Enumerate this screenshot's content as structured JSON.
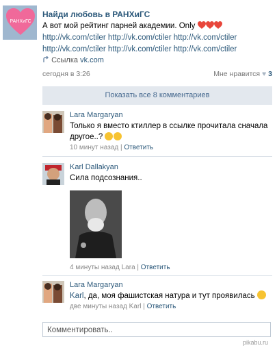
{
  "group": {
    "name": "Найди любовь в РАНХиГС",
    "logo_text": "РАНХиГС"
  },
  "post": {
    "text_line1": "А вот мой рейтинг парней академии. Only",
    "text_line2": "http://vk.com/ctiler http://vk.com/ctiler http://vk.com/ctiler",
    "text_line3": "http://vk.com/ctiler http://vk.com/ctiler http://vk.com/ctiler",
    "link_label": "Ссылка",
    "link_url": "vk.com",
    "timestamp": "сегодня в 3:26",
    "likes_label": "Мне нравится",
    "likes_count": "3"
  },
  "show_all_comments": "Показать все 8 комментариев",
  "comments": [
    {
      "author": "Lara Margaryan",
      "text": "Только я вместо ктиллер в ссылке прочитала сначала другое..?",
      "time": "10 минут назад",
      "reply_label": "Ответить"
    },
    {
      "author": "Karl Dallakyan",
      "text": "Сила подсознания..",
      "time": "4 минуты назад",
      "reply_to": "Lara",
      "reply_label": "Ответить"
    },
    {
      "author": "Lara Margaryan",
      "mention": "Karl",
      "text": ", да, моя фашистская натура и тут проявилась",
      "time": "две минуты назад",
      "reply_to": "Karl",
      "reply_label": "Ответить"
    }
  ],
  "comment_input": {
    "placeholder": "Комментировать.."
  },
  "watermark": "pikabu.ru",
  "colors": {
    "link": "#2b587a",
    "button_bg": "#e3e8ee",
    "avatar_bg": "#9fb7cf",
    "heart": "#f0699a"
  }
}
